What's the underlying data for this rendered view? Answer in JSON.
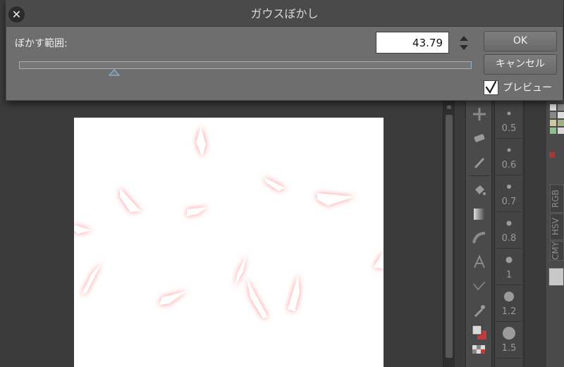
{
  "dialog": {
    "title": "ガウスぼかし",
    "blur_range_label": "ぼかす範囲:",
    "blur_value": "43.79",
    "slider_fraction": 0.21,
    "ok_label": "OK",
    "cancel_label": "キャンセル",
    "preview_label": "プレビュー",
    "preview_checked": true
  },
  "brush_sizes": [
    "0.5",
    "0.6",
    "0.7",
    "0.8",
    "1",
    "1.2",
    "1.5"
  ],
  "color_panel_tabs": [
    "RGB",
    "HSV",
    "CMY"
  ],
  "colors": {
    "dialog_bg": "#6e6e6e",
    "titlebar_bg": "#4a4a4a",
    "slider_border": "#88b7d8",
    "shard_glow": "#ff8a8a",
    "canvas_bg": "#ffffff",
    "app_bg": "#3b3b3b"
  },
  "icons": {
    "close": "close-icon",
    "spinner": "up-down-spinner-icon",
    "checkmark": "checkmark-icon"
  }
}
